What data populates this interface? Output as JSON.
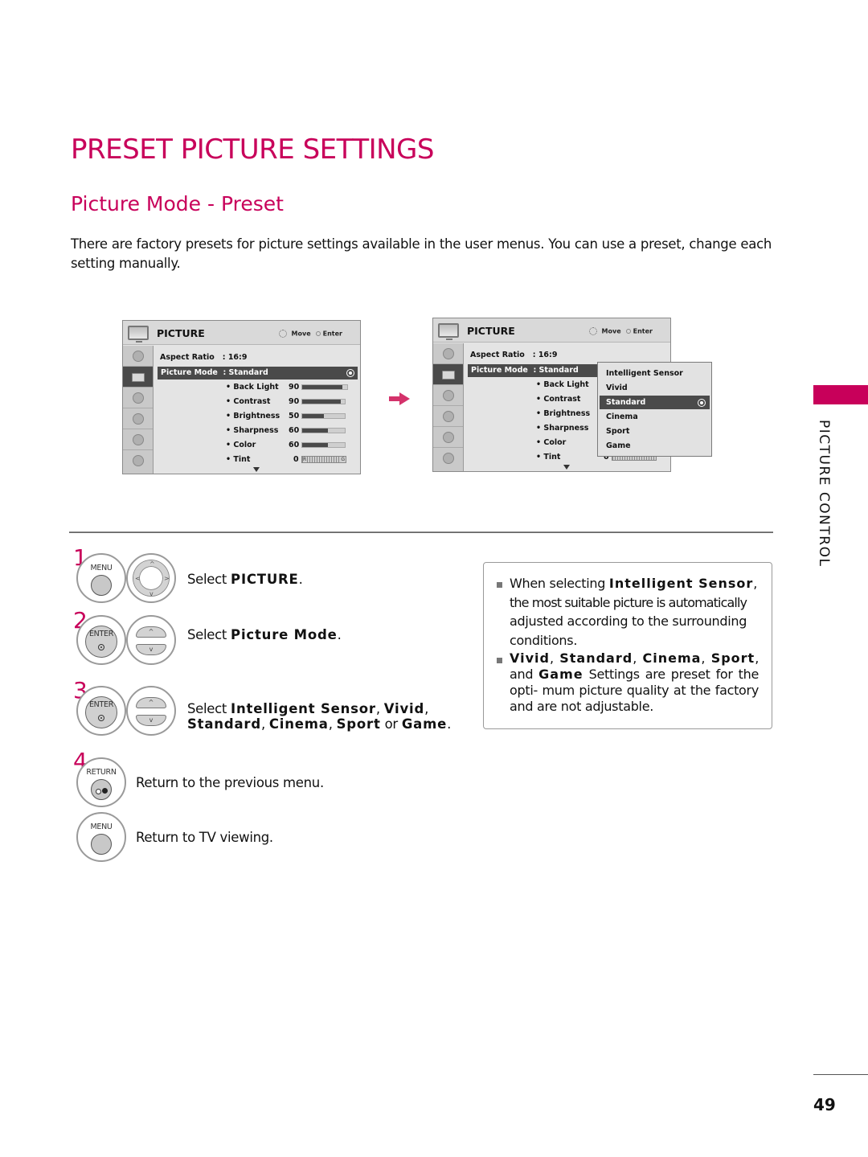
{
  "page": {
    "title": "PRESET PICTURE SETTINGS",
    "subtitle": "Picture Mode - Preset",
    "intro": "There are factory presets for picture settings available in the user menus. You can use a preset, change each setting manually.",
    "side_label": "PICTURE CONTROL",
    "page_number": "49",
    "accent_color": "#c8005a"
  },
  "menu_left": {
    "title": "PICTURE",
    "hint_move": "Move",
    "hint_enter": "Enter",
    "aspect_label": "Aspect Ratio",
    "aspect_value": ": 16:9",
    "mode_label": "Picture Mode",
    "mode_value": ": Standard",
    "settings": [
      {
        "label": "• Back Light",
        "value": "90",
        "level": 90
      },
      {
        "label": "• Contrast",
        "value": "90",
        "level": 90
      },
      {
        "label": "• Brightness",
        "value": "50",
        "level": 50
      },
      {
        "label": "• Sharpness",
        "value": "60",
        "level": 60
      },
      {
        "label": "• Color",
        "value": "60",
        "level": 60
      },
      {
        "label": "• Tint",
        "value": "0",
        "tint_left": "R",
        "tint_right": "G"
      }
    ]
  },
  "menu_right": {
    "title": "PICTURE",
    "hint_move": "Move",
    "hint_enter": "Enter",
    "aspect_label": "Aspect Ratio",
    "aspect_value": ": 16:9",
    "mode_label": "Picture Mode",
    "mode_value": ": Standard",
    "settings": [
      "• Back Light",
      "• Contrast",
      "• Brightness",
      "• Sharpness",
      "• Color",
      "• Tint"
    ],
    "tint_value": "0",
    "dropdown": {
      "options": [
        "Intelligent Sensor",
        "Vivid",
        "Standard",
        "Cinema",
        "Sport",
        "Game"
      ],
      "selected": "Standard"
    }
  },
  "steps": [
    {
      "number": "1",
      "button": "MENU",
      "prefix": "Select ",
      "bold": "PICTURE",
      "suffix": "."
    },
    {
      "number": "2",
      "button": "ENTER",
      "prefix": "Select ",
      "bold": "Picture Mode",
      "suffix": "."
    },
    {
      "number": "3",
      "button": "ENTER",
      "line1_prefix": "Select ",
      "line1_bold1": "Intelligent Sensor",
      "line1_sep": ", ",
      "line1_bold2": "Vivid",
      "line1_end": ",",
      "line2_bold1": "Standard",
      "line2_sep1": ", ",
      "line2_bold2": "Cinema",
      "line2_sep2": ", ",
      "line2_bold3": "Sport",
      "line2_or": " or ",
      "line2_bold4": "Game",
      "line2_end": "."
    },
    {
      "number": "4",
      "button": "RETURN",
      "text": "Return to the previous menu."
    },
    {
      "number": "",
      "button": "MENU",
      "text": "Return to TV viewing."
    }
  ],
  "note": {
    "item1_prefix": "When selecting ",
    "item1_bold": "Intelligent Sensor",
    "item1_line2": "the most suitable picture is automatically",
    "item1_line3": "adjusted according to the surrounding",
    "item1_line4": "conditions.",
    "item2_b1": "Vivid",
    "item2_b2": "Standard",
    "item2_b3": "Cinema",
    "item2_b4": "Sport",
    "item2_and": ", and",
    "item2_b5": "Game",
    "item2_rest": " Settings are preset for the opti- mum picture quality at the factory and are not adjustable."
  }
}
